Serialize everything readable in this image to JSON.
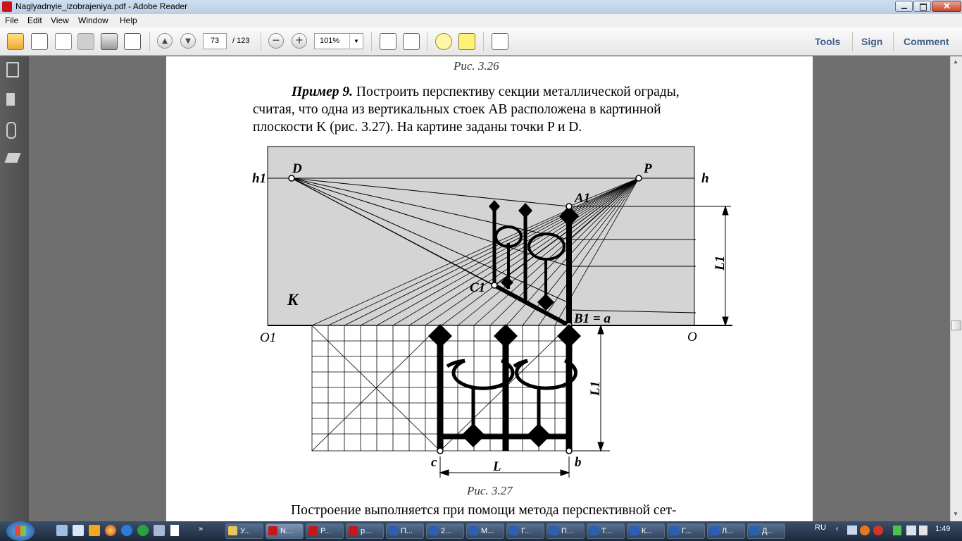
{
  "window": {
    "title": "Naglyadnyie_izobrajeniya.pdf - Adobe Reader"
  },
  "menu": [
    "File",
    "Edit",
    "View",
    "Window",
    "Help"
  ],
  "toolbar": {
    "page_current": "73",
    "page_total": "/ 123",
    "zoom": "101%",
    "tools_label": "Tools",
    "sign_label": "Sign",
    "comment_label": "Comment"
  },
  "document": {
    "caption_top": "Рис. 3.26",
    "example_label": "Пример 9.",
    "example_line1": "Построить перспективу секции металлической ограды,",
    "example_line2": "считая, что одна из вертикальных стоек AB расположена в картинной",
    "example_line3": "плоскости K (рис. 3.27). На картине заданы точки P и D.",
    "caption_bottom": "Рис. 3.27",
    "body_start": "Построение выполняется при помощи метода перспективной сет-"
  },
  "figure": {
    "labels": {
      "h1": "h1",
      "h": "h",
      "D": "D",
      "P": "P",
      "A1": "A1",
      "C1": "C1",
      "B1": "B1 = a",
      "K": "K",
      "O1": "O1",
      "O": "O",
      "L1_top": "L1",
      "L1_bottom": "L1",
      "c": "c",
      "b": "b",
      "L": "L"
    }
  },
  "taskbar": {
    "buttons": [
      "У...",
      "N...",
      "Р...",
      "р...",
      "П...",
      "2...",
      "М...",
      "Г...",
      "П...",
      "Т...",
      "К...",
      "Г...",
      "Л...",
      "Д..."
    ],
    "active_index": 1,
    "lang": "RU",
    "clock": "1:49"
  },
  "colors": {
    "plane_fill": "#d4d4d4",
    "link_color": "#3e5e8c",
    "taskbar": "#2b3b52"
  }
}
